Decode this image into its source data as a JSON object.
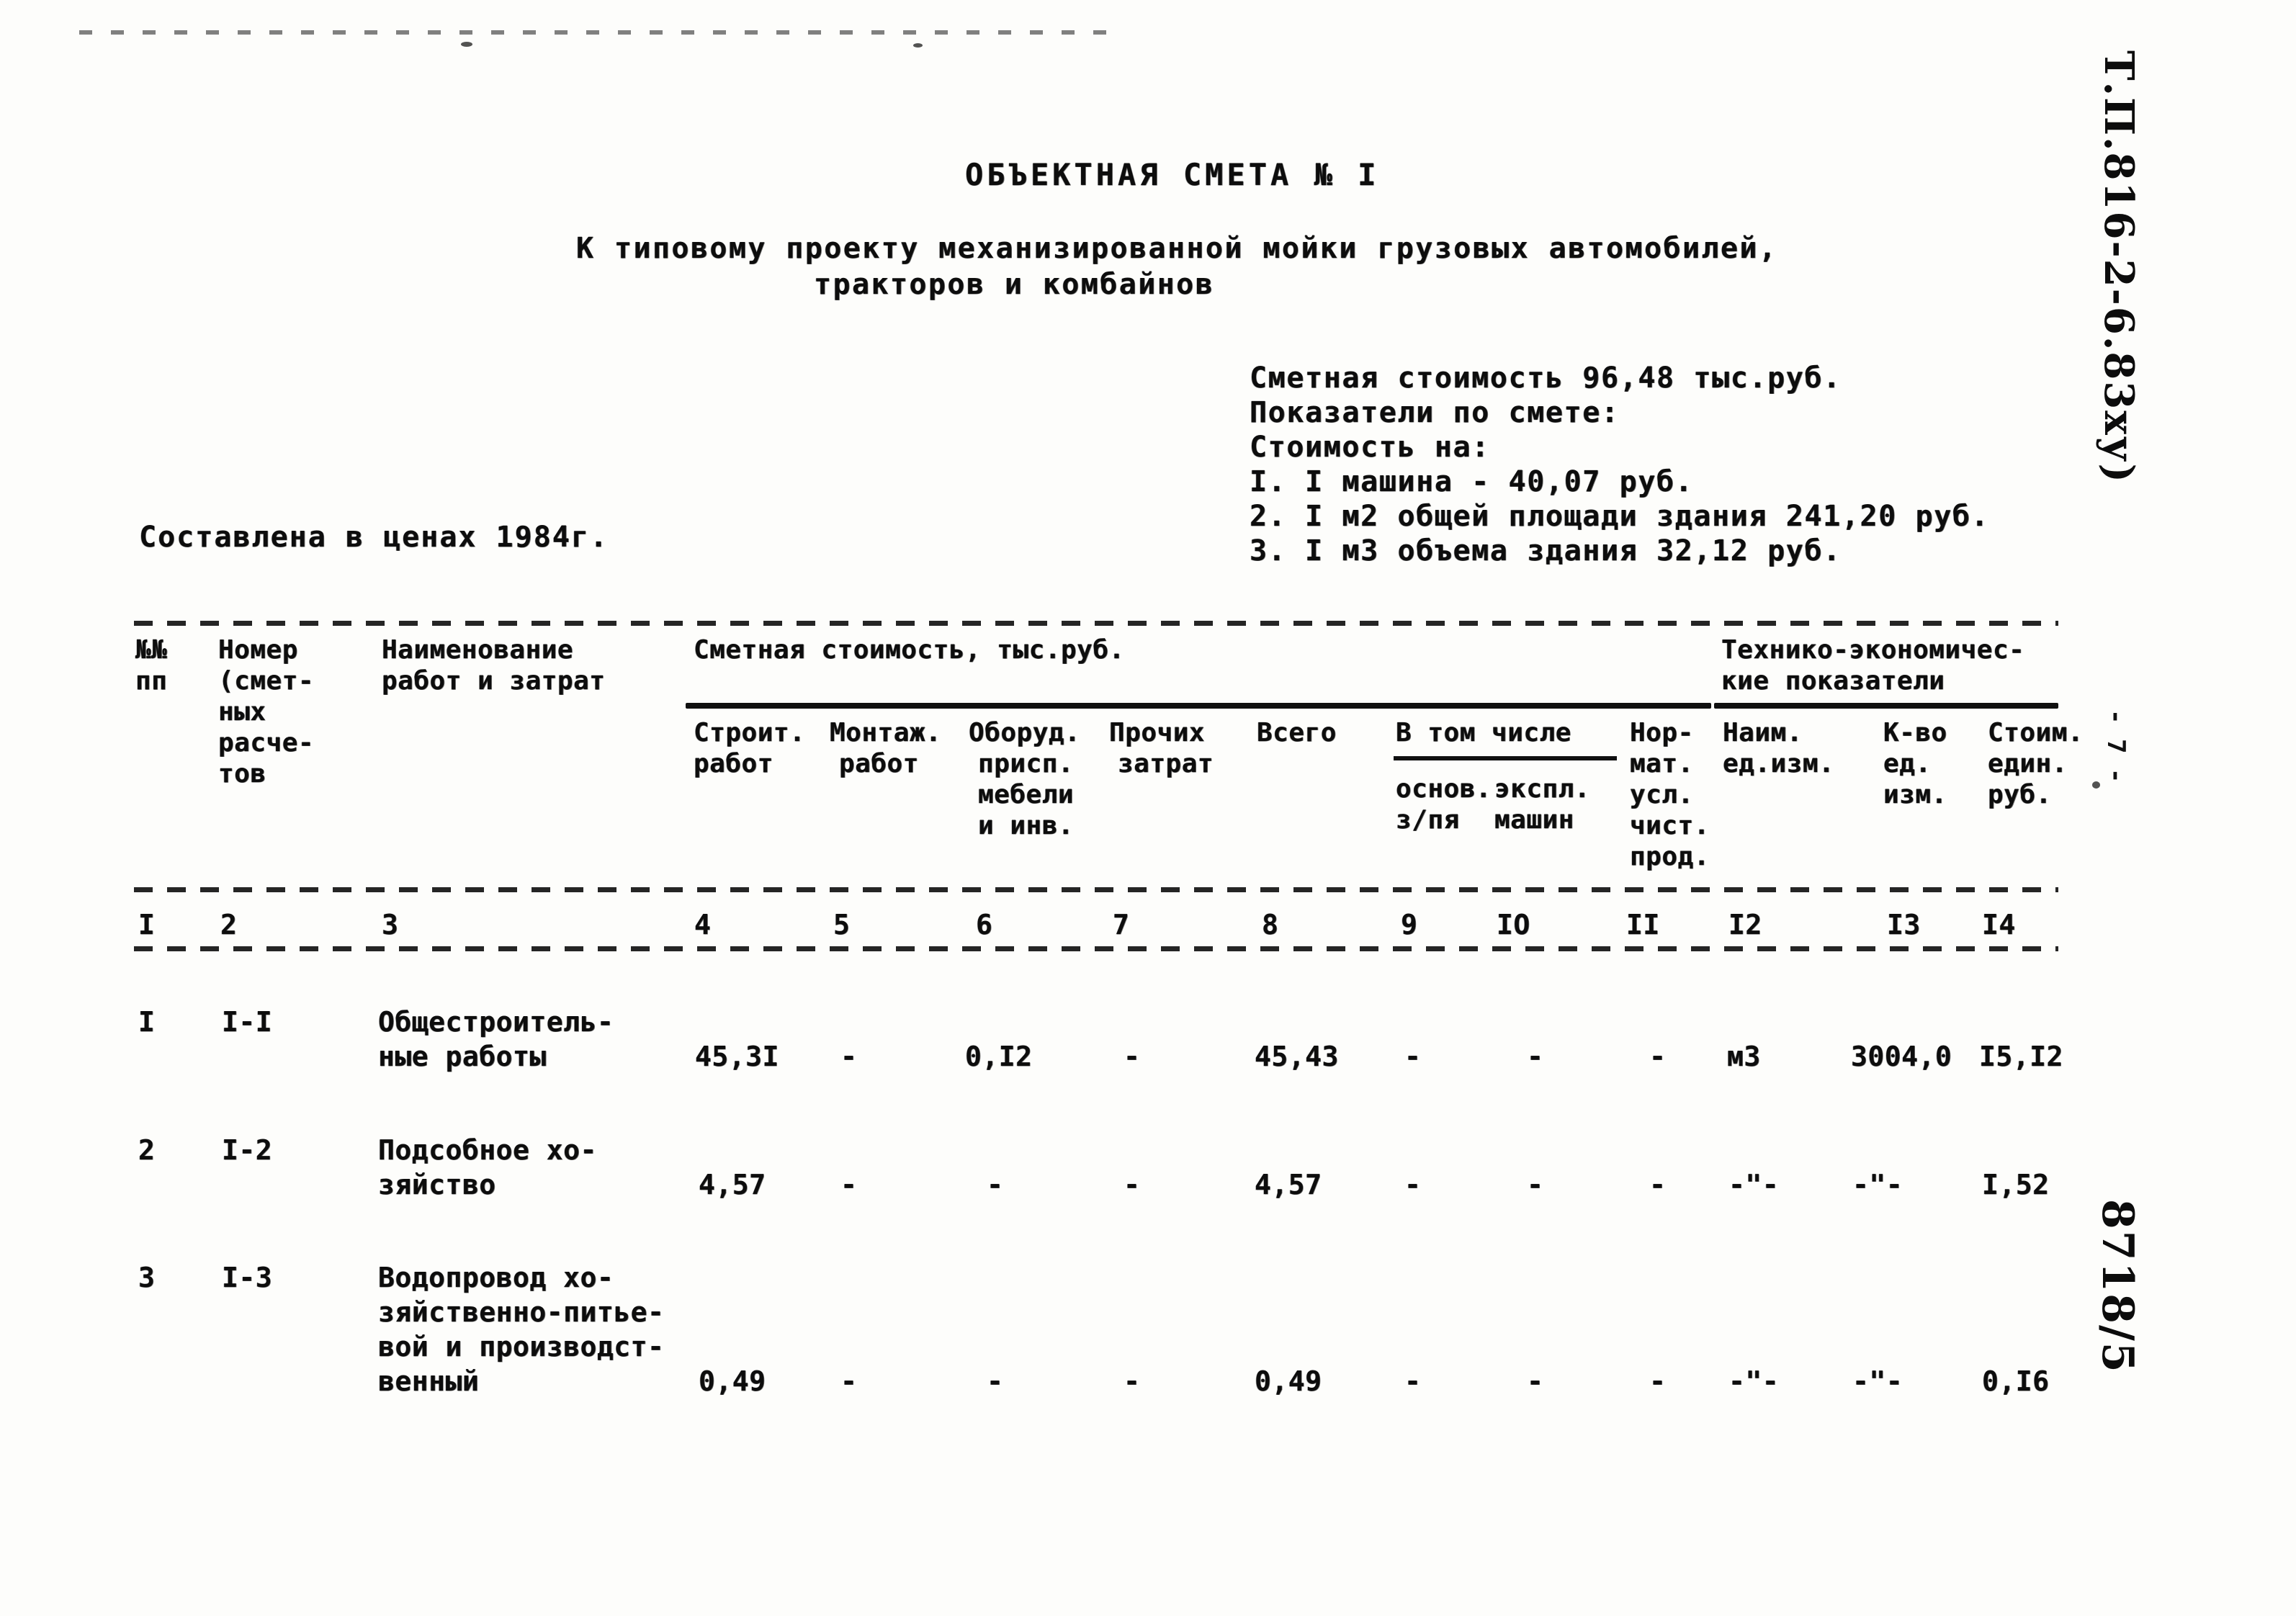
{
  "document": {
    "title": "ОБЪЕКТНАЯ СМЕТА № I",
    "subtitle_line1": "К типовому проекту механизированной мойки грузовых автомобилей,",
    "subtitle_line2": "тракторов и комбайнов",
    "prices_note": "Составлена в ценах 1984г."
  },
  "summary": {
    "line1": "Сметная стоимость 96,48 тыс.руб.",
    "line2": "Показатели по смете:",
    "line3": "Стоимость на:",
    "item1": "I. I машина - 40,07 руб.",
    "item2": "2. I м2 общей площади здания 241,20 руб.",
    "item3": "3. I м3 объема здания 32,12 руб."
  },
  "margin": {
    "top_right_code": "Т.П.816-2-6.83ху)",
    "page_number": "- 7 -",
    "bottom_right_code": "8718/5"
  },
  "table": {
    "group_headers": {
      "estimate_cost": "Сметная стоимость, тыс.руб.",
      "tech_econ_line1": "Технико-экономичес-",
      "tech_econ_line2": "кие показатели"
    },
    "headers": {
      "col1_line1": "№№",
      "col1_line2": "пп",
      "col2_line1": "Номер",
      "col2_line2": "(смет-",
      "col2_line3": "ных",
      "col2_line4": "расче-",
      "col2_line5": "тов",
      "col3_line1": "Наименование",
      "col3_line2": "работ и затрат",
      "col4_line1": "Строит.",
      "col4_line2": "работ",
      "col5_line1": "Монтаж.",
      "col5_line2": "работ",
      "col6_line1": "Оборуд.",
      "col6_line2": "присп.",
      "col6_line3": "мебели",
      "col6_line4": "и инв.",
      "col7_line1": "Прочих",
      "col7_line2": "затрат",
      "col8_line1": "Всего",
      "col9_group": "В том числе",
      "col9_line1": "основ.",
      "col9_line2": "з/пя",
      "col10_line1": "экспл.",
      "col10_line2": "машин",
      "col11_line1": "Нор-",
      "col11_line2": "мат.",
      "col11_line3": "усл.",
      "col11_line4": "чист.",
      "col11_line5": "прод.",
      "col12_line1": "Наим.",
      "col12_line2": "ед.изм.",
      "col13_line1": "К-во",
      "col13_line2": "ед.",
      "col13_line3": "изм.",
      "col14_line1": "Стоим.",
      "col14_line2": "един.",
      "col14_line3": "руб."
    },
    "column_numbers": [
      "I",
      "2",
      "3",
      "4",
      "5",
      "6",
      "7",
      "8",
      "9",
      "IO",
      "II",
      "I2",
      "I3",
      "I4"
    ],
    "rows": [
      {
        "no": "I",
        "estimate_no": "I-I",
        "name_line1": "Общестроитель-",
        "name_line2": "ные работы",
        "name_line3": "",
        "name_line4": "",
        "construction": "45,3I",
        "installation": "-",
        "equipment": "0,I2",
        "other": "-",
        "total": "45,43",
        "base_wage": "-",
        "machines": "-",
        "norm_product": "-",
        "unit_name": "м3",
        "unit_qty": "3004,0",
        "unit_cost": "I5,I2"
      },
      {
        "no": "2",
        "estimate_no": "I-2",
        "name_line1": "Подсобное хо-",
        "name_line2": "зяйство",
        "name_line3": "",
        "name_line4": "",
        "construction": "4,57",
        "installation": "-",
        "equipment": "-",
        "other": "-",
        "total": "4,57",
        "base_wage": "-",
        "machines": "-",
        "norm_product": "-",
        "unit_name": "-\"-",
        "unit_qty": "-\"-",
        "unit_cost": "I,52"
      },
      {
        "no": "3",
        "estimate_no": "I-3",
        "name_line1": "Водопровод хо-",
        "name_line2": "зяйственно-питье-",
        "name_line3": "вой и производст-",
        "name_line4": "венный",
        "construction": "0,49",
        "installation": "-",
        "equipment": "-",
        "other": "-",
        "total": "0,49",
        "base_wage": "-",
        "machines": "-",
        "norm_product": "-",
        "unit_name": "-\"-",
        "unit_qty": "-\"-",
        "unit_cost": "0,I6"
      }
    ]
  }
}
